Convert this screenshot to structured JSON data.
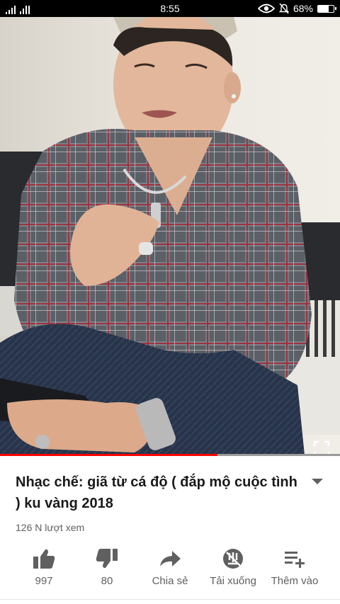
{
  "status_bar": {
    "signal_text": "ıl",
    "time": "8:55",
    "battery_percent": "68%",
    "battery_level": 0.68
  },
  "video": {
    "progress_fraction": 0.64,
    "accent_color": "#ff0000"
  },
  "title": "Nhạc chế: giã từ cá độ ( đắp mộ cuộc tình ) ku vàng 2018",
  "views": "126 N lượt xem",
  "actions": [
    {
      "icon": "thumbs-up-icon",
      "label": "997"
    },
    {
      "icon": "thumbs-down-icon",
      "label": "80"
    },
    {
      "icon": "share-icon",
      "label": "Chia sẻ"
    },
    {
      "icon": "download-icon",
      "label": "Tải xuống"
    },
    {
      "icon": "add-to-playlist-icon",
      "label": "Thêm vào"
    }
  ]
}
